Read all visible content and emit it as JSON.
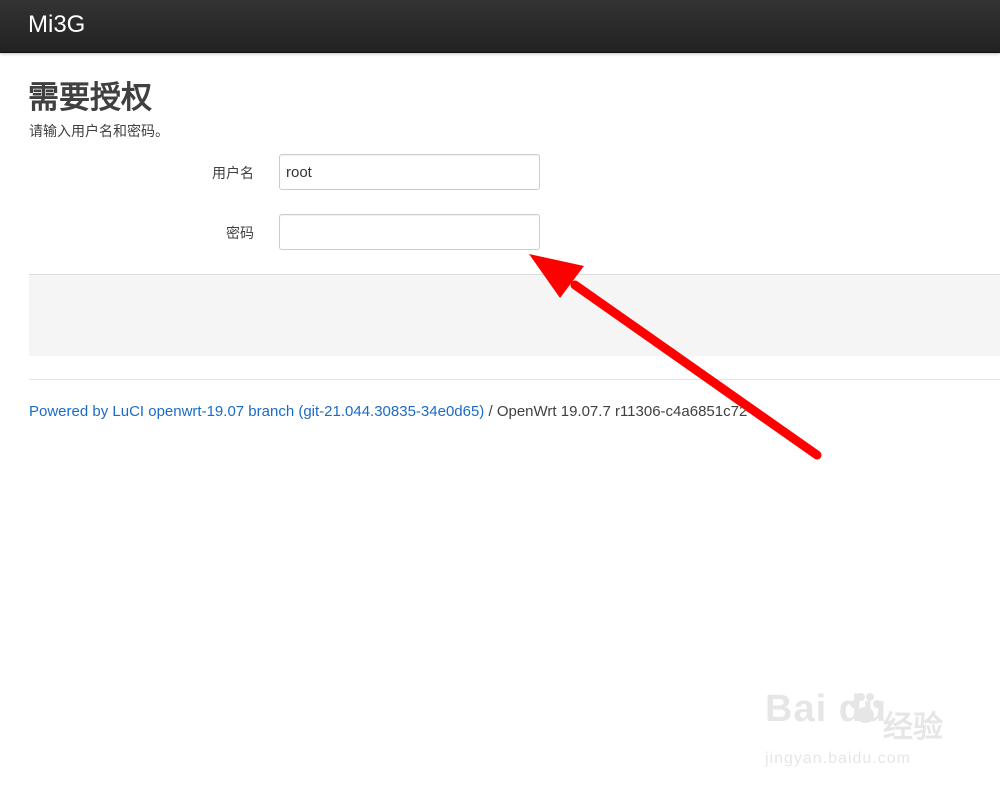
{
  "header": {
    "brand": "Mi3G"
  },
  "main": {
    "title": "需要授权",
    "description": "请输入用户名和密码。",
    "username_label": "用户名",
    "username_value": "root",
    "password_label": "密码",
    "password_value": ""
  },
  "footer": {
    "powered_by": "Powered by LuCI openwrt-19.07 branch (git-21.044.30835-34e0d65)",
    "separator": " / ",
    "version": "OpenWrt 19.07.7 r11306-c4a6851c72"
  },
  "annotation": {
    "arrow_color": "#ff0000"
  },
  "watermark": {
    "logo": "Bai du",
    "cn": "经验",
    "url": "jingyan.baidu.com"
  }
}
